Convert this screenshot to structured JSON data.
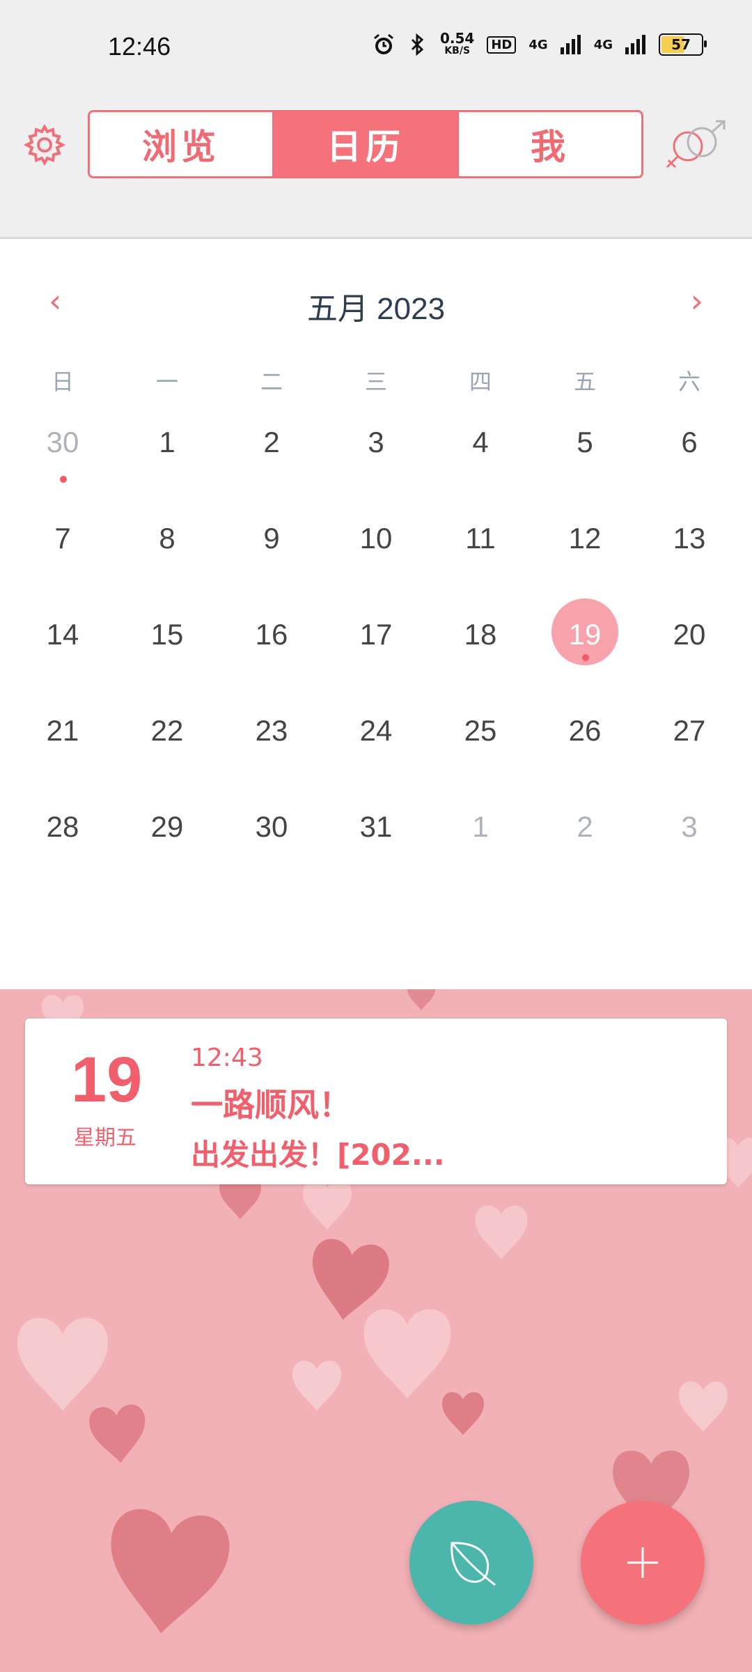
{
  "status": {
    "time": "12:46",
    "speed_value": "0.54",
    "speed_unit": "KB/S",
    "hd_badge": "HD",
    "net1": "4G",
    "net2": "4G",
    "battery": "57"
  },
  "header": {
    "tabs": [
      {
        "label": "浏览",
        "active": false
      },
      {
        "label": "日历",
        "active": true
      },
      {
        "label": "我",
        "active": false
      }
    ],
    "settings_icon": "gear-icon",
    "gender_icon": "gender-symbol-icon"
  },
  "calendar": {
    "prev_label": "‹",
    "next_label": "›",
    "month_title": "五月 2023",
    "weekdays": [
      "日",
      "一",
      "二",
      "三",
      "四",
      "五",
      "六"
    ],
    "weeks": [
      [
        "30",
        "1",
        "2",
        "3",
        "4",
        "5",
        "6"
      ],
      [
        "7",
        "8",
        "9",
        "10",
        "11",
        "12",
        "13"
      ],
      [
        "14",
        "15",
        "16",
        "17",
        "18",
        "19",
        "20"
      ],
      [
        "21",
        "22",
        "23",
        "24",
        "25",
        "26",
        "27"
      ],
      [
        "28",
        "29",
        "30",
        "31",
        "1",
        "2",
        "3"
      ]
    ]
  },
  "event": {
    "day": "19",
    "weekday": "星期五",
    "time": "12:43",
    "line1": "一路顺风！",
    "line2": "出发出发！[202..."
  },
  "fabs": {
    "leaf_icon": "leaf-icon",
    "add_icon": "plus-icon"
  },
  "colors": {
    "accent": "#f6727a",
    "teal": "#4cb6ad",
    "background_pink": "#f2b1b6"
  }
}
